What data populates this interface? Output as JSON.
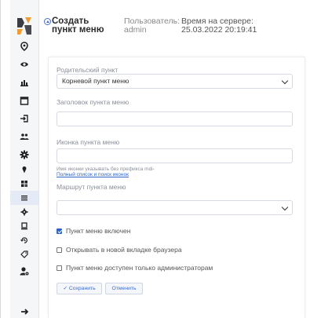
{
  "header": {
    "title": "Создать пункт меню",
    "user_label": "Пользователь:",
    "user_name": "admin",
    "server_time_label": "Время на сервере:",
    "server_time": "25.03.2022 20:19:41"
  },
  "sidebar": {
    "items": [
      {
        "icon": "map-pin-icon"
      },
      {
        "icon": "eye-icon"
      },
      {
        "icon": "bar-chart-icon"
      },
      {
        "icon": "calendar-icon"
      },
      {
        "icon": "login-icon"
      },
      {
        "icon": "users-icon"
      },
      {
        "icon": "gear-icon"
      },
      {
        "icon": "pin-icon"
      },
      {
        "icon": "grid-icon"
      },
      {
        "icon": "menu-lines-icon",
        "active": true
      },
      {
        "icon": "cog-small-icon"
      },
      {
        "icon": "document-icon"
      },
      {
        "icon": "history-icon"
      },
      {
        "icon": "tag-icon"
      },
      {
        "icon": "user-settings-icon"
      },
      {
        "icon": "arrow-icon"
      }
    ]
  },
  "form": {
    "parent_label": "Родительский пункт",
    "parent_value": "Корневой пункт меню",
    "title_label": "Заголовок пункта меню",
    "title_value": "",
    "icon_label": "Иконка пункта меню",
    "icon_value": "",
    "icon_hint": "Имя иконки указывать без префикса mdi-",
    "icon_hint_link": "Полный список и поиск иконок",
    "route_label": "Маршрут пункта меню",
    "route_value": "",
    "enabled_label": "Пункт меню включен",
    "enabled_checked": true,
    "new_tab_label": "Открывать в новой вкладке браузера",
    "new_tab_checked": false,
    "admin_only_label": "Пункт меню доступен только администраторам",
    "admin_only_checked": false,
    "save_label": "✓ Сохранить",
    "cancel_label": "Отменить"
  },
  "colors": {
    "accent": "#2f63c6",
    "sidebar_bg": "#f5f6f8",
    "logo_orange": "#f39c34",
    "logo_dark": "#3b3b44"
  }
}
